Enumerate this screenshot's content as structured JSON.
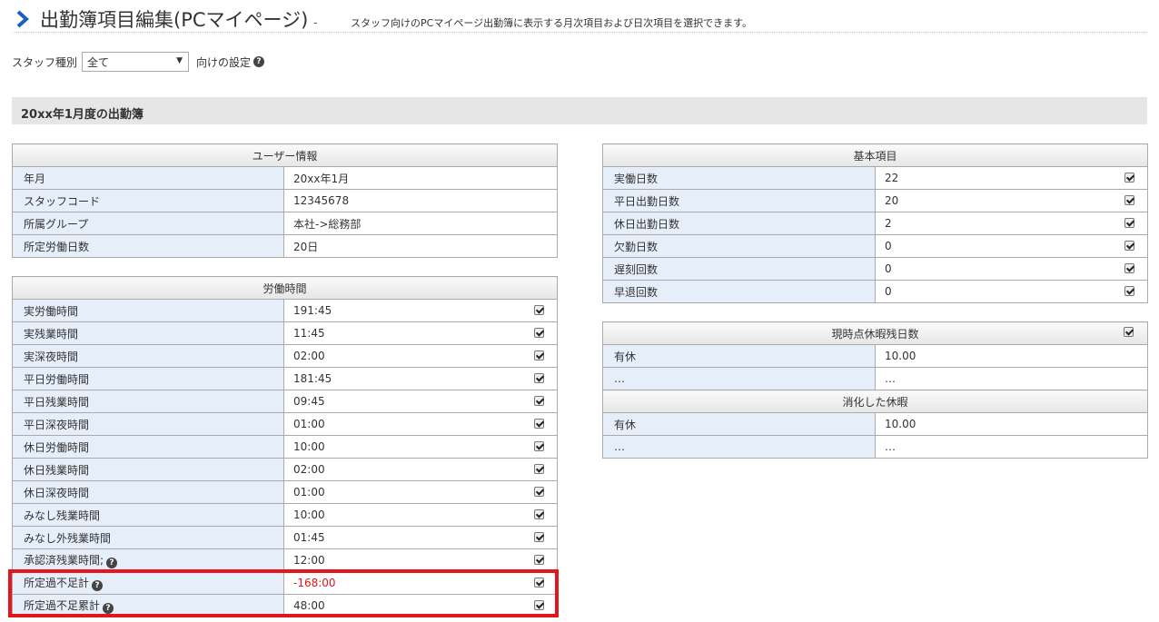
{
  "header": {
    "title": "出勤簿項目編集(PCマイページ)",
    "dash": "-",
    "description": "スタッフ向けのPCマイページ出勤簿に表示する月次項目および日次項目を選択できます。"
  },
  "staff_filter": {
    "label": "スタッフ種別",
    "selected": "全て",
    "suffix": "向けの設定"
  },
  "month_heading": "20xx年1月度の出勤簿",
  "user_info": {
    "title": "ユーザー情報",
    "rows": [
      {
        "label": "年月",
        "value": "20xx年1月"
      },
      {
        "label": "スタッフコード",
        "value": "12345678"
      },
      {
        "label": "所属グループ",
        "value": "本社->総務部"
      },
      {
        "label": "所定労働日数",
        "value": "20日"
      }
    ]
  },
  "work_time": {
    "title": "労働時間",
    "rows": [
      {
        "label": "実労働時間",
        "value": "191:45",
        "checked": true
      },
      {
        "label": "実残業時間",
        "value": "11:45",
        "checked": true
      },
      {
        "label": "実深夜時間",
        "value": "02:00",
        "checked": true
      },
      {
        "label": "平日労働時間",
        "value": "181:45",
        "checked": true
      },
      {
        "label": "平日残業時間",
        "value": "09:45",
        "checked": true
      },
      {
        "label": "平日深夜時間",
        "value": "01:00",
        "checked": true
      },
      {
        "label": "休日労働時間",
        "value": "10:00",
        "checked": true
      },
      {
        "label": "休日残業時間",
        "value": "02:00",
        "checked": true
      },
      {
        "label": "休日深夜時間",
        "value": "01:00",
        "checked": true
      },
      {
        "label": "みなし残業時間",
        "value": "10:00",
        "checked": true
      },
      {
        "label": "みなし外残業時間",
        "value": "01:45",
        "checked": true
      },
      {
        "label": "承認済残業時間;",
        "value": "12:00",
        "checked": true
      },
      {
        "label": "所定過不足計",
        "value": "-168:00",
        "checked": true
      },
      {
        "label": "所定過不足累計",
        "value": "48:00",
        "checked": true
      }
    ]
  },
  "basic_items": {
    "title": "基本項目",
    "rows": [
      {
        "label": "実働日数",
        "value": "22",
        "checked": true
      },
      {
        "label": "平日出勤日数",
        "value": "20",
        "checked": true
      },
      {
        "label": "休日出勤日数",
        "value": "2",
        "checked": true
      },
      {
        "label": "欠勤日数",
        "value": "0",
        "checked": true
      },
      {
        "label": "遅刻回数",
        "value": "0",
        "checked": true
      },
      {
        "label": "早退回数",
        "value": "0",
        "checked": true
      }
    ]
  },
  "leave": {
    "title_remaining": "現時点休暇残日数",
    "remaining": [
      {
        "label": "有休",
        "value": "10.00"
      },
      {
        "label": "…",
        "value": "…"
      }
    ],
    "title_used": "消化した休暇",
    "used": [
      {
        "label": "有休",
        "value": "10.00"
      },
      {
        "label": "…",
        "value": "…"
      }
    ]
  },
  "colors": {
    "accent": "#1a5fc1",
    "negative": "#e0161a",
    "highlight_border": "#e3161f",
    "label_bg": "#e6eef9"
  }
}
